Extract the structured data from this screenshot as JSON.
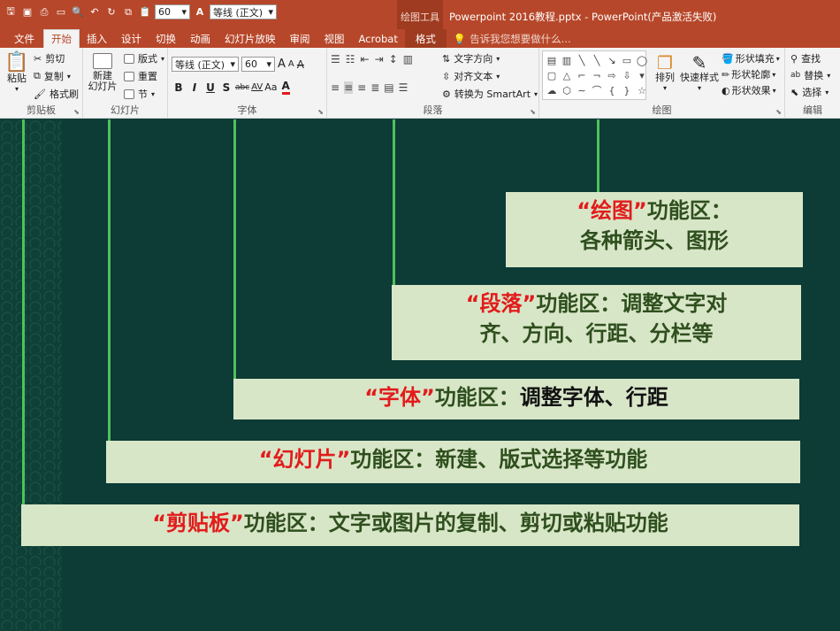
{
  "titlebar": {
    "font_size_value": "60",
    "font_name_value": "等线 (正文)",
    "font_color_glyph": "A",
    "context_label": "绘图工具",
    "window_title": "Powerpoint 2016教程.pptx - PowerPoint(产品激活失败)"
  },
  "tabs": [
    "文件",
    "开始",
    "插入",
    "设计",
    "切换",
    "动画",
    "幻灯片放映",
    "审阅",
    "视图",
    "Acrobat",
    "格式"
  ],
  "tell_me": "告诉我您想要做什么...",
  "ribbon": {
    "clipboard": {
      "paste": "粘贴",
      "cut": "剪切",
      "copy": "复制",
      "format_painter": "格式刷",
      "label": "剪贴板"
    },
    "slides": {
      "new_slide_line1": "新建",
      "new_slide_line2": "幻灯片",
      "layout": "版式",
      "reset": "重置",
      "section": "节",
      "label": "幻灯片"
    },
    "font": {
      "name": "等线 (正文)",
      "size": "60",
      "grow": "A",
      "shrink": "A",
      "clear": "A",
      "bold": "B",
      "italic": "I",
      "underline": "U",
      "shadow": "S",
      "strike": "abc",
      "spacing": "AV",
      "case": "Aa",
      "color": "A",
      "label": "字体"
    },
    "paragraph": {
      "text_direction": "文字方向",
      "align_text": "对齐文本",
      "smartart": "转换为 SmartArt",
      "label": "段落"
    },
    "drawing": {
      "arrange": "排列",
      "quick_styles": "快速样式",
      "shape_fill": "形状填充",
      "shape_outline": "形状轮廓",
      "shape_effects": "形状效果",
      "label": "绘图"
    },
    "editing": {
      "find": "查找",
      "replace": "替换",
      "select": "选择",
      "label": "编辑"
    }
  },
  "slide": {
    "callouts": [
      {
        "quoted": "“绘图”",
        "suffix": "功能区：",
        "line2": "各种箭头、图形"
      },
      {
        "quoted": "“段落”",
        "suffix": "功能区：",
        "line1_tail": "调整文字对",
        "line2": "齐、方向、行距、分栏等"
      },
      {
        "quoted": "“字体”",
        "suffix": "功能区：",
        "tail": "调整字体、行距"
      },
      {
        "quoted": "“幻灯片”",
        "suffix": "功能区：",
        "tail": "新建、版式选择等功能"
      },
      {
        "quoted": "“剪贴板”",
        "suffix": "功能区：",
        "tail": "文字或图片的复制、剪切或粘贴功能"
      }
    ]
  },
  "colors": {
    "accent": "#b7472a",
    "slide_bg": "#0d3b35",
    "callout_bg": "#d8e6c8",
    "line": "#4cc25a",
    "highlight": "#e21b1b"
  }
}
